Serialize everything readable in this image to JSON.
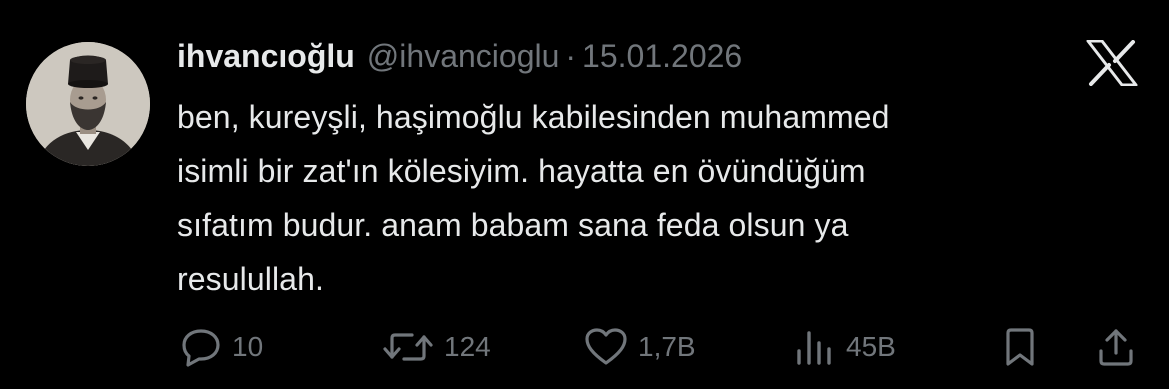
{
  "tweet": {
    "display_name": "ihvancıoğlu",
    "handle": "@ihvancioglu",
    "separator": "·",
    "date": "15.01.2026",
    "text_lines": [
      "ben, kureyşli, haşimoğlu kabilesinden muhammed",
      "isimli bir zat'ın kölesiyim. hayatta en övündüğüm",
      "sıfatım budur. anam babam sana feda olsun ya",
      "resulullah."
    ]
  },
  "actions": {
    "replies": "10",
    "reposts": "124",
    "likes": "1,7B",
    "views": "45B"
  },
  "icons": {
    "platform": "x-logo-icon",
    "reply": "reply-icon",
    "repost": "repost-icon",
    "like": "heart-icon",
    "views": "views-icon",
    "bookmark": "bookmark-icon",
    "share": "share-icon"
  },
  "colors": {
    "background": "#000000",
    "primary_text": "#e7e9ea",
    "secondary_text": "#71767b"
  }
}
